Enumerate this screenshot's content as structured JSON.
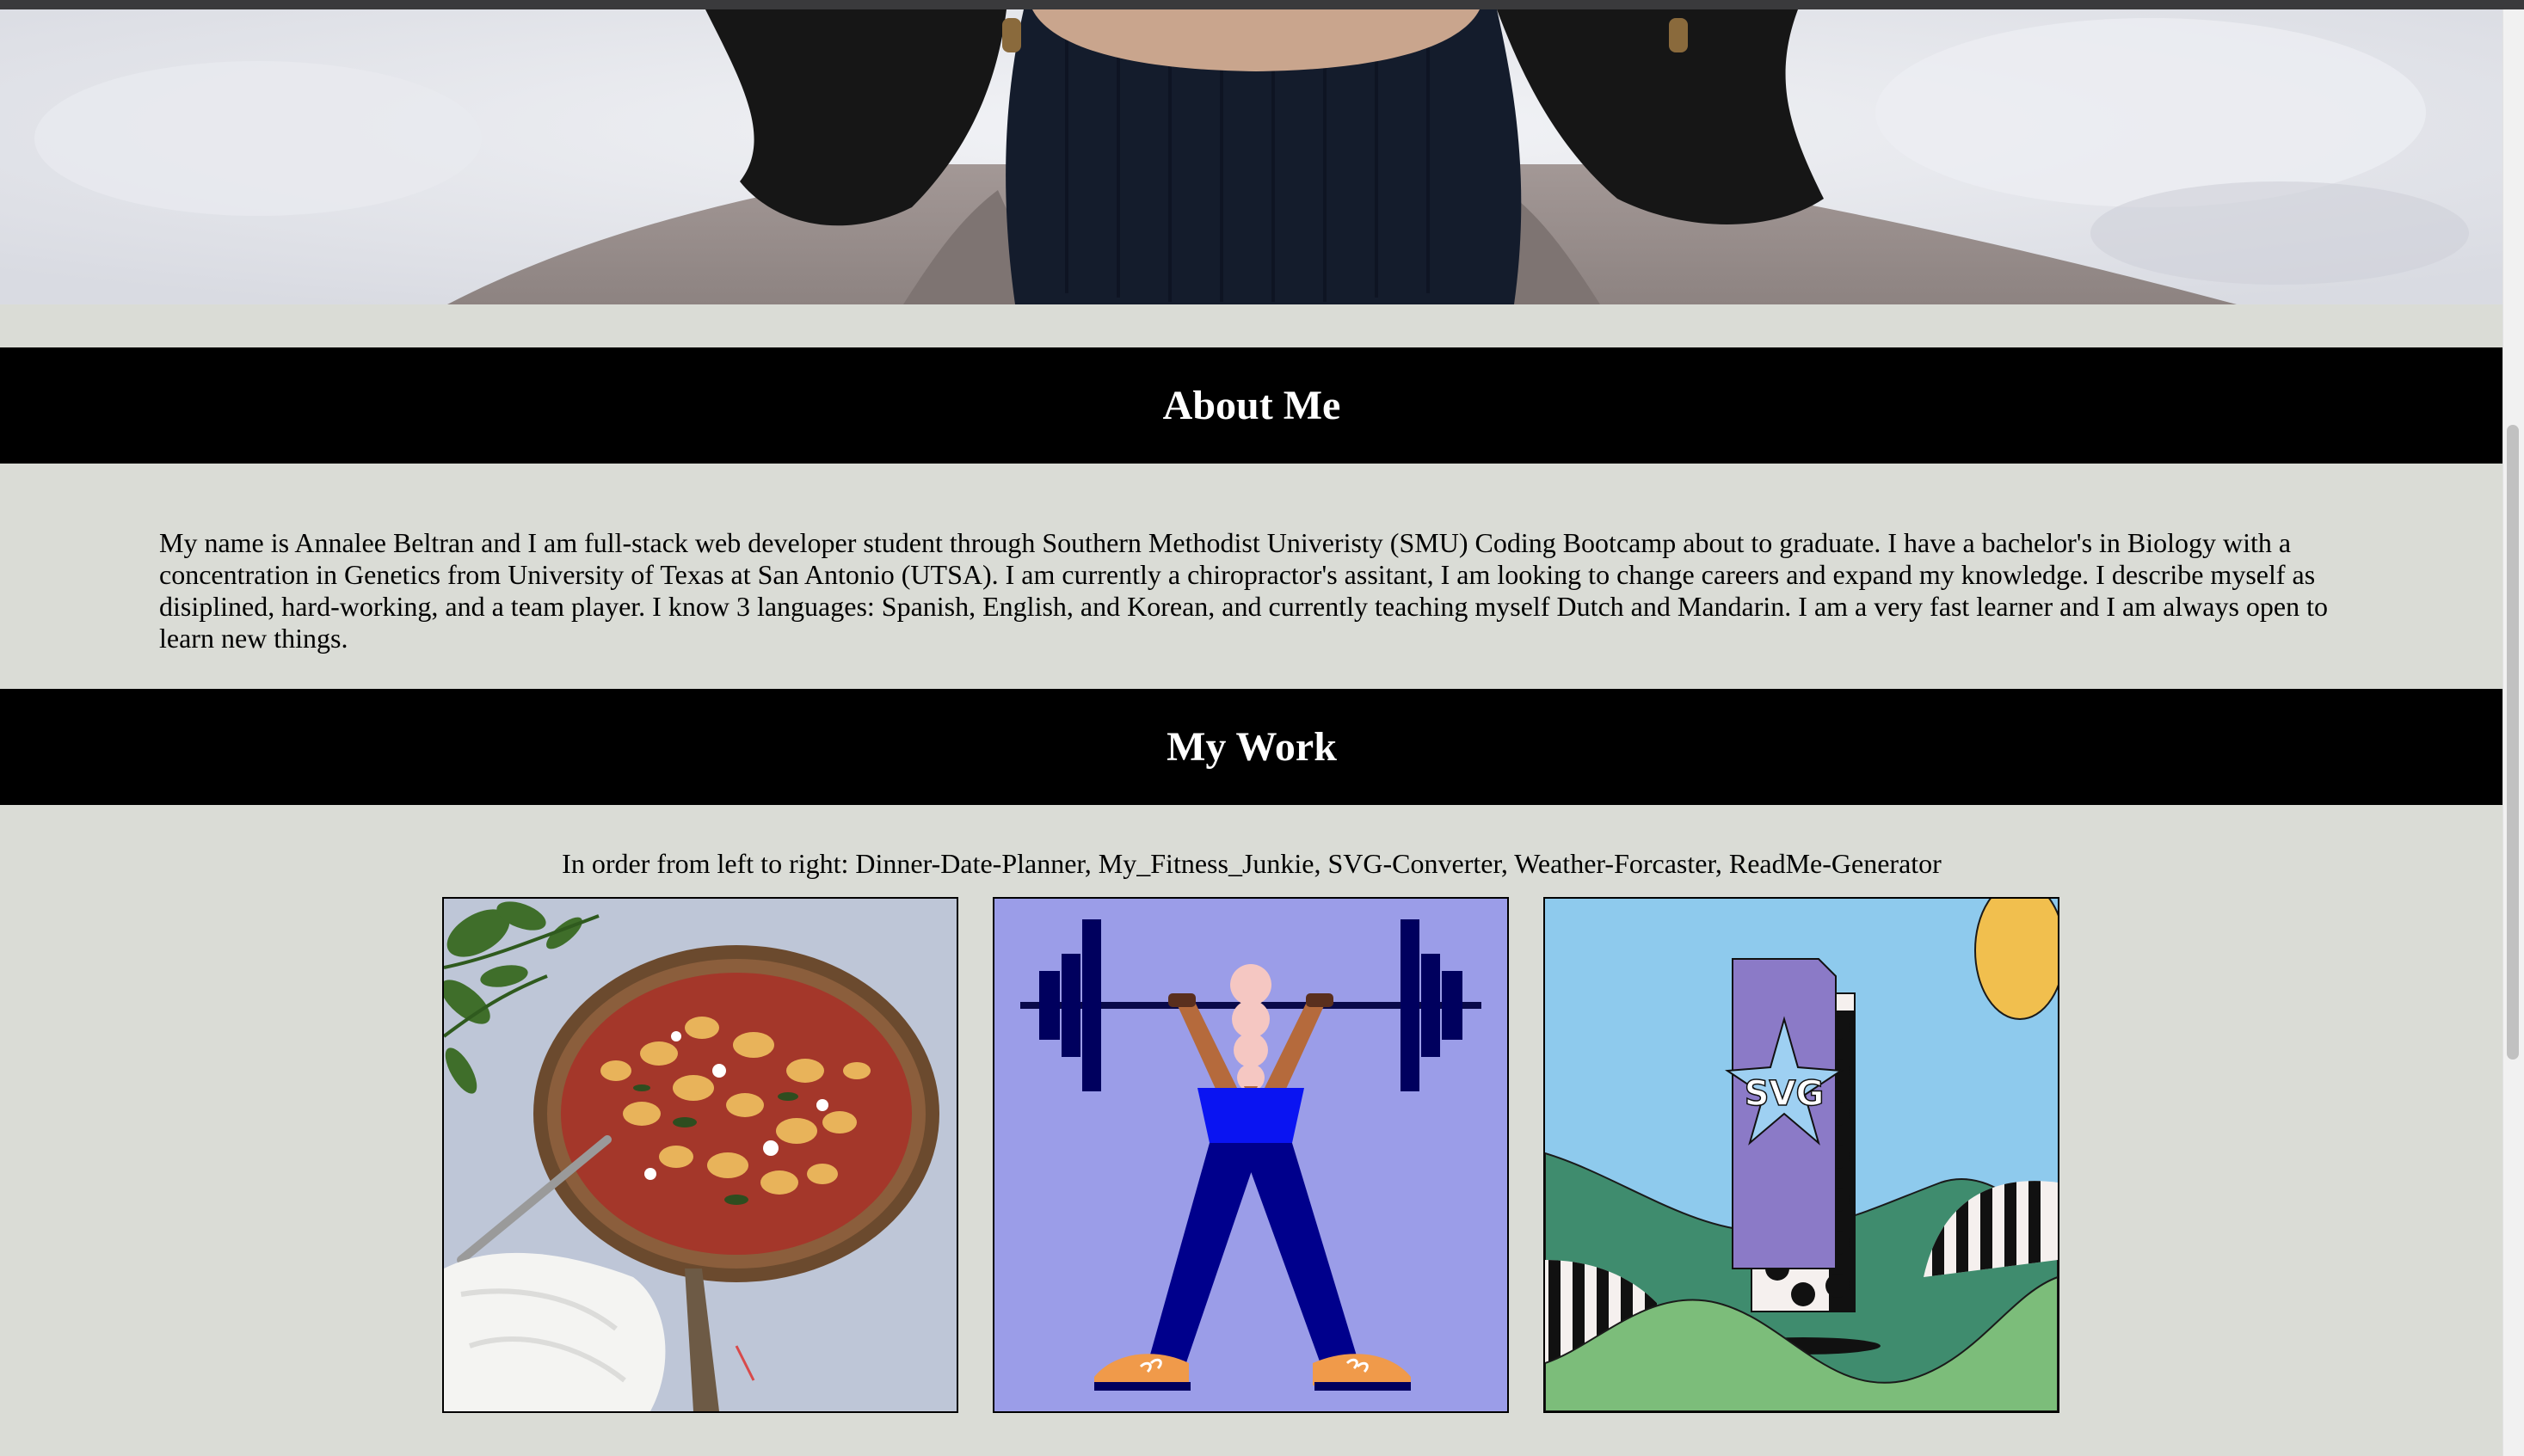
{
  "about": {
    "heading": "About Me",
    "text": "My name is Annalee Beltran and I am full-stack web developer student through Southern Methodist Univeristy (SMU) Coding Bootcamp about to graduate. I have a bachelor's in Biology with a concentration in Genetics from University of Texas at San Antonio (UTSA). I am currently a chiropractor's assitant, I am looking to change careers and expand my knowledge. I describe myself as disiplined, hard-working, and a team player. I know 3 languages: Spanish, English, and Korean, and currently teaching myself Dutch and Mandarin. I am a very fast learner and I am always open to learn new things."
  },
  "work": {
    "heading": "My Work",
    "caption": "In order from left to right: Dinner-Date-Planner, My_Fitness_Junkie, SVG-Converter, Weather-Forcaster, ReadMe-Generator",
    "thumbnails": [
      {
        "icon": "pasta-skillet-image"
      },
      {
        "icon": "weightlifter-illustration"
      },
      {
        "icon": "svg-file-illustration",
        "badge_text": "SVG"
      }
    ]
  },
  "colors": {
    "background": "#dadcd6",
    "banner": "#000000",
    "banner_text": "#ffffff"
  }
}
